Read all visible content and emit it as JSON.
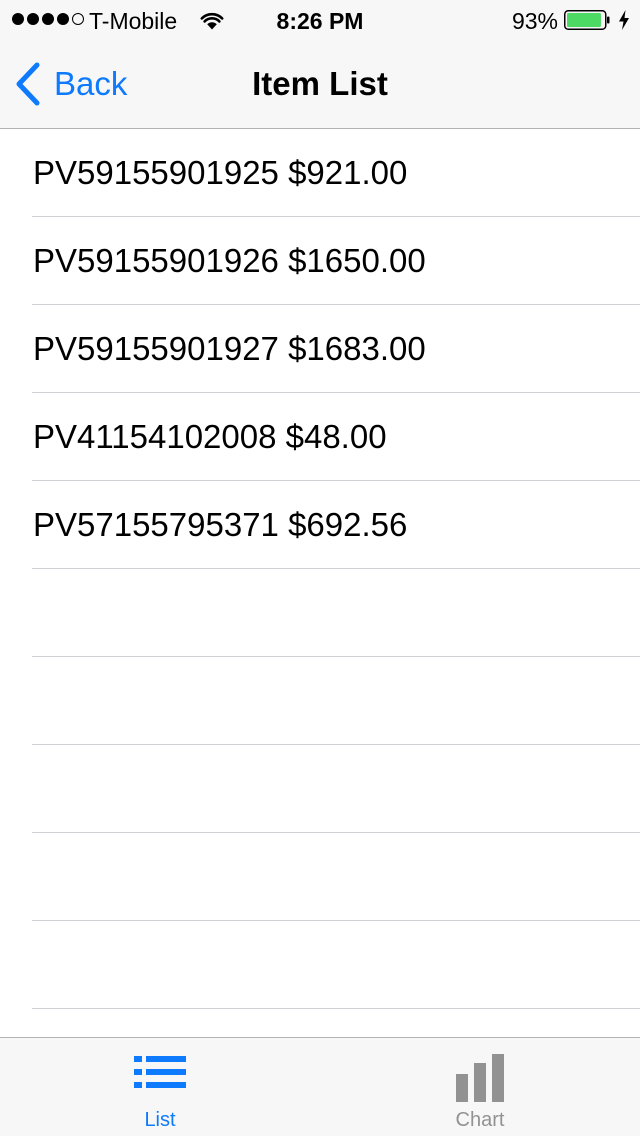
{
  "status_bar": {
    "carrier": "T-Mobile",
    "time": "8:26 PM",
    "battery_percent": "93%",
    "signal_bars_filled": 4,
    "signal_bars_total": 5,
    "battery_level": 0.93,
    "battery_color": "#4cd964"
  },
  "nav": {
    "back_label": "Back",
    "title": "Item List",
    "tint_color": "#0e7afe"
  },
  "items": [
    {
      "label": "PV59155901925 $921.00"
    },
    {
      "label": "PV59155901926 $1650.00"
    },
    {
      "label": "PV59155901927 $1683.00"
    },
    {
      "label": "PV41154102008 $48.00"
    },
    {
      "label": "PV57155795371 $692.56"
    },
    {
      "label": ""
    },
    {
      "label": ""
    },
    {
      "label": ""
    },
    {
      "label": ""
    },
    {
      "label": ""
    },
    {
      "label": ""
    }
  ],
  "tab_bar": {
    "tabs": [
      {
        "label": "List",
        "icon": "list-icon",
        "selected": true
      },
      {
        "label": "Chart",
        "icon": "bar-chart-icon",
        "selected": false
      }
    ],
    "selected_color": "#0e7afe",
    "unselected_color": "#929292"
  }
}
